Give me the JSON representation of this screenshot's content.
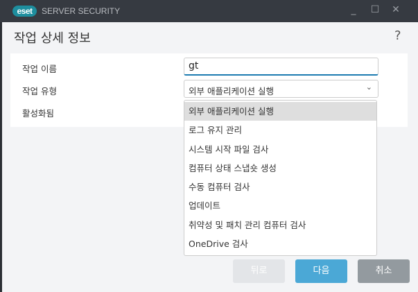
{
  "window": {
    "logo": "eset",
    "product": "SERVER SECURITY",
    "minimize": "_",
    "maximize": "☐",
    "close": "✕"
  },
  "header": {
    "title": "작업 상세 정보",
    "help": "?"
  },
  "form": {
    "name_label": "작업 이름",
    "name_value": "gt",
    "type_label": "작업 유형",
    "type_value": "외부 애플리케이션 실행",
    "enabled_label": "활성화됨"
  },
  "dropdown": {
    "options": [
      "외부 애플리케이션 실행",
      "로그 유지 관리",
      "시스템 시작 파일 검사",
      "컴퓨터 상태 스냅숏 생성",
      "수동 컴퓨터 검사",
      "업데이트",
      "취약성 및 패치 관리 컴퓨터 검사",
      "OneDrive 검사"
    ]
  },
  "buttons": {
    "back": "뒤로",
    "next": "다음",
    "cancel": "취소"
  },
  "colors": {
    "accent": "#4ba8d6",
    "cancel": "#939a9f",
    "back_disabled": "#e3e5e8"
  }
}
